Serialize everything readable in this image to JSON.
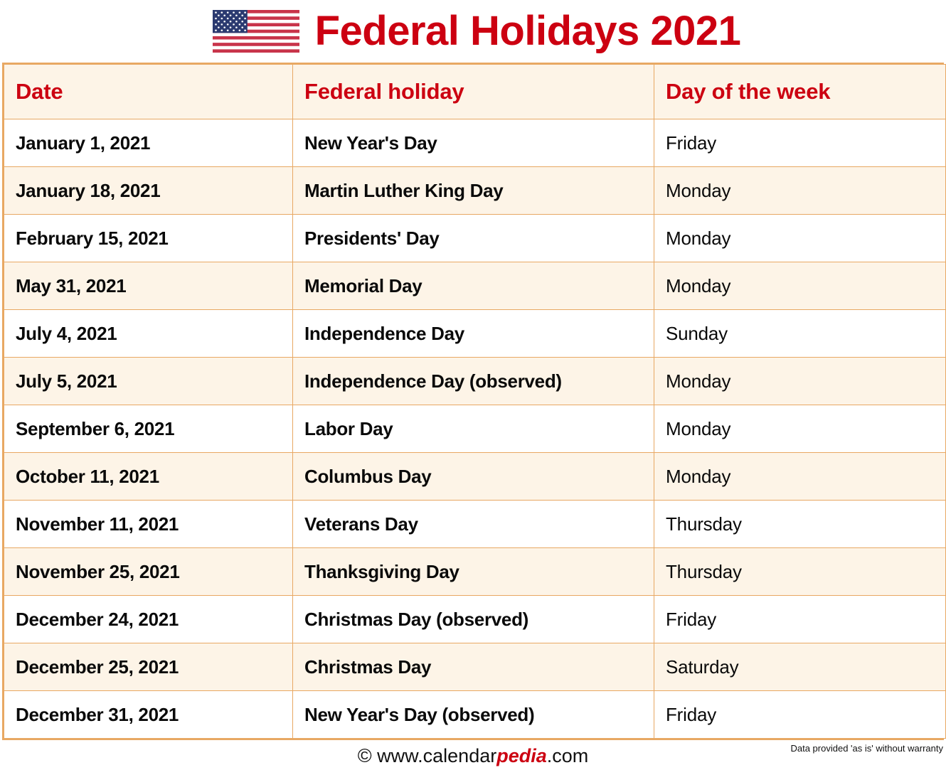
{
  "header": {
    "title": "Federal Holidays 2021",
    "flag_icon": "us-flag-icon"
  },
  "table": {
    "columns": [
      "Date",
      "Federal holiday",
      "Day of the week"
    ],
    "rows": [
      {
        "date": "January 1, 2021",
        "holiday": "New Year's Day",
        "day": "Friday"
      },
      {
        "date": "January 18, 2021",
        "holiday": "Martin Luther King Day",
        "day": "Monday"
      },
      {
        "date": "February 15, 2021",
        "holiday": "Presidents' Day",
        "day": "Monday"
      },
      {
        "date": "May 31, 2021",
        "holiday": "Memorial Day",
        "day": "Monday"
      },
      {
        "date": "July 4, 2021",
        "holiday": "Independence Day",
        "day": "Sunday"
      },
      {
        "date": "July 5, 2021",
        "holiday": "Independence Day (observed)",
        "day": "Monday"
      },
      {
        "date": "September 6, 2021",
        "holiday": "Labor Day",
        "day": "Monday"
      },
      {
        "date": "October 11, 2021",
        "holiday": "Columbus Day",
        "day": "Monday"
      },
      {
        "date": "November 11, 2021",
        "holiday": "Veterans Day",
        "day": "Thursday"
      },
      {
        "date": "November 25, 2021",
        "holiday": "Thanksgiving Day",
        "day": "Thursday"
      },
      {
        "date": "December 24, 2021",
        "holiday": "Christmas Day (observed)",
        "day": "Friday"
      },
      {
        "date": "December 25, 2021",
        "holiday": "Christmas Day",
        "day": "Saturday"
      },
      {
        "date": "December 31, 2021",
        "holiday": "New Year's Day (observed)",
        "day": "Friday"
      }
    ]
  },
  "footer": {
    "copyright_symbol": "©",
    "site_prefix": "www.calendar",
    "site_brand": "pedia",
    "site_suffix": ".com",
    "disclaimer": "Data provided 'as is' without warranty"
  },
  "colors": {
    "accent_red": "#CC0011",
    "border_tan": "#E8A863",
    "row_cream": "#FDF4E7",
    "row_white": "#FFFFFF"
  }
}
